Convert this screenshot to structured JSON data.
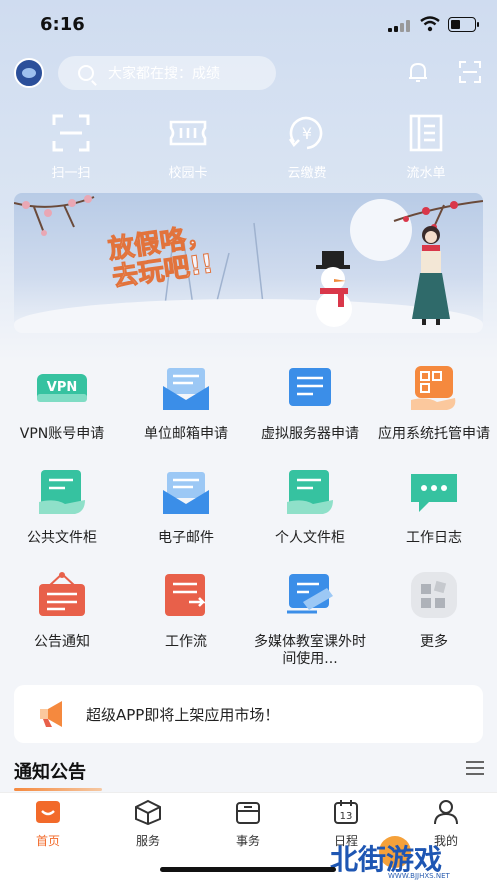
{
  "status_bar": {
    "time": "6:16"
  },
  "search": {
    "placeholder": "大家都在搜：成绩"
  },
  "quick_actions": [
    {
      "label": "扫一扫",
      "icon": "scan-icon"
    },
    {
      "label": "校园卡",
      "icon": "campus-card-icon"
    },
    {
      "label": "云缴费",
      "icon": "yuan-payment-icon"
    },
    {
      "label": "流水单",
      "icon": "statement-icon"
    }
  ],
  "banner": {
    "title_line1": "放假咯，",
    "title_line2": "去玩吧!!"
  },
  "apps": [
    {
      "label": "VPN账号申请",
      "icon": "vpn-icon",
      "color": "#36c2a0"
    },
    {
      "label": "单位邮箱申请",
      "icon": "mailbox-icon",
      "color": "#3b8ee8"
    },
    {
      "label": "虚拟服务器申请",
      "icon": "virtual-server-icon",
      "color": "#3b8ee8"
    },
    {
      "label": "应用系统托管申请",
      "icon": "app-hosting-icon",
      "color": "#f5893e"
    },
    {
      "label": "公共文件柜",
      "icon": "public-file-icon",
      "color": "#36c2a0"
    },
    {
      "label": "电子邮件",
      "icon": "email-icon",
      "color": "#3b8ee8"
    },
    {
      "label": "个人文件柜",
      "icon": "personal-file-icon",
      "color": "#36c2a0"
    },
    {
      "label": "工作日志",
      "icon": "work-log-icon",
      "color": "#36c2a0"
    },
    {
      "label": "公告通知",
      "icon": "announcement-icon",
      "color": "#e8604a"
    },
    {
      "label": "工作流",
      "icon": "workflow-icon",
      "color": "#e8604a"
    },
    {
      "label": "多媒体教室课外时间使用...",
      "icon": "multimedia-classroom-icon",
      "color": "#3b8ee8"
    },
    {
      "label": "更多",
      "icon": "more-icon",
      "color": "#c9ccd2"
    }
  ],
  "notice": {
    "text": "超级APP即将上架应用市场！"
  },
  "section": {
    "title": "通知公告"
  },
  "tabs": [
    {
      "label": "首页",
      "icon": "home-icon",
      "active": true
    },
    {
      "label": "服务",
      "icon": "service-cube-icon",
      "active": false
    },
    {
      "label": "事务",
      "icon": "affairs-icon",
      "active": false
    },
    {
      "label": "日程",
      "icon": "calendar-icon",
      "active": false
    },
    {
      "label": "我的",
      "icon": "profile-icon",
      "active": false
    }
  ],
  "watermark": {
    "text": "北街游戏",
    "sub": "WWW.BJJHXS.NET"
  },
  "colors": {
    "accent": "#f26a2a",
    "header_bg": "#cfdcf0"
  }
}
